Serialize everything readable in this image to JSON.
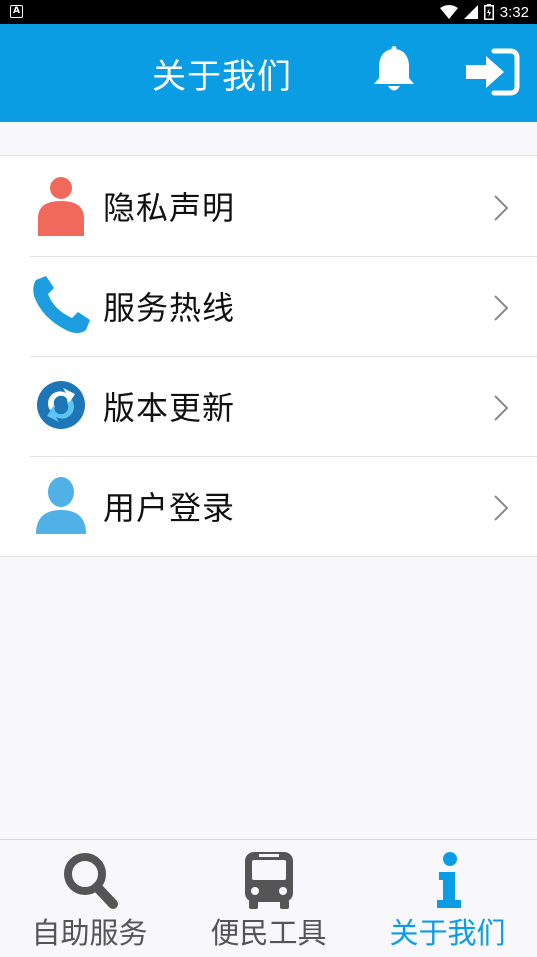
{
  "status_bar": {
    "notification_glyph": "A",
    "time": "3:32",
    "icons": [
      "wifi-icon",
      "signal-icon",
      "battery-icon"
    ]
  },
  "header": {
    "title": "关于我们",
    "bell_icon": "bell-icon",
    "login_icon": "sign-in-icon",
    "color": "#0b9de4"
  },
  "menu": {
    "items": [
      {
        "label": "隐私声明",
        "icon": "privacy-person-icon",
        "icon_color": "#f0695a"
      },
      {
        "label": "服务热线",
        "icon": "phone-icon",
        "icon_color": "#1b9de0"
      },
      {
        "label": "版本更新",
        "icon": "refresh-icon",
        "icon_color": "#1d76b8"
      },
      {
        "label": "用户登录",
        "icon": "user-icon",
        "icon_color": "#4fb1e6"
      }
    ]
  },
  "bottom_nav": {
    "tabs": [
      {
        "label": "自助服务",
        "icon": "search-icon",
        "active": false
      },
      {
        "label": "便民工具",
        "icon": "bus-icon",
        "active": false
      },
      {
        "label": "关于我们",
        "icon": "info-icon",
        "active": true
      }
    ],
    "active_color": "#0b9de4",
    "inactive_color": "#555555"
  }
}
